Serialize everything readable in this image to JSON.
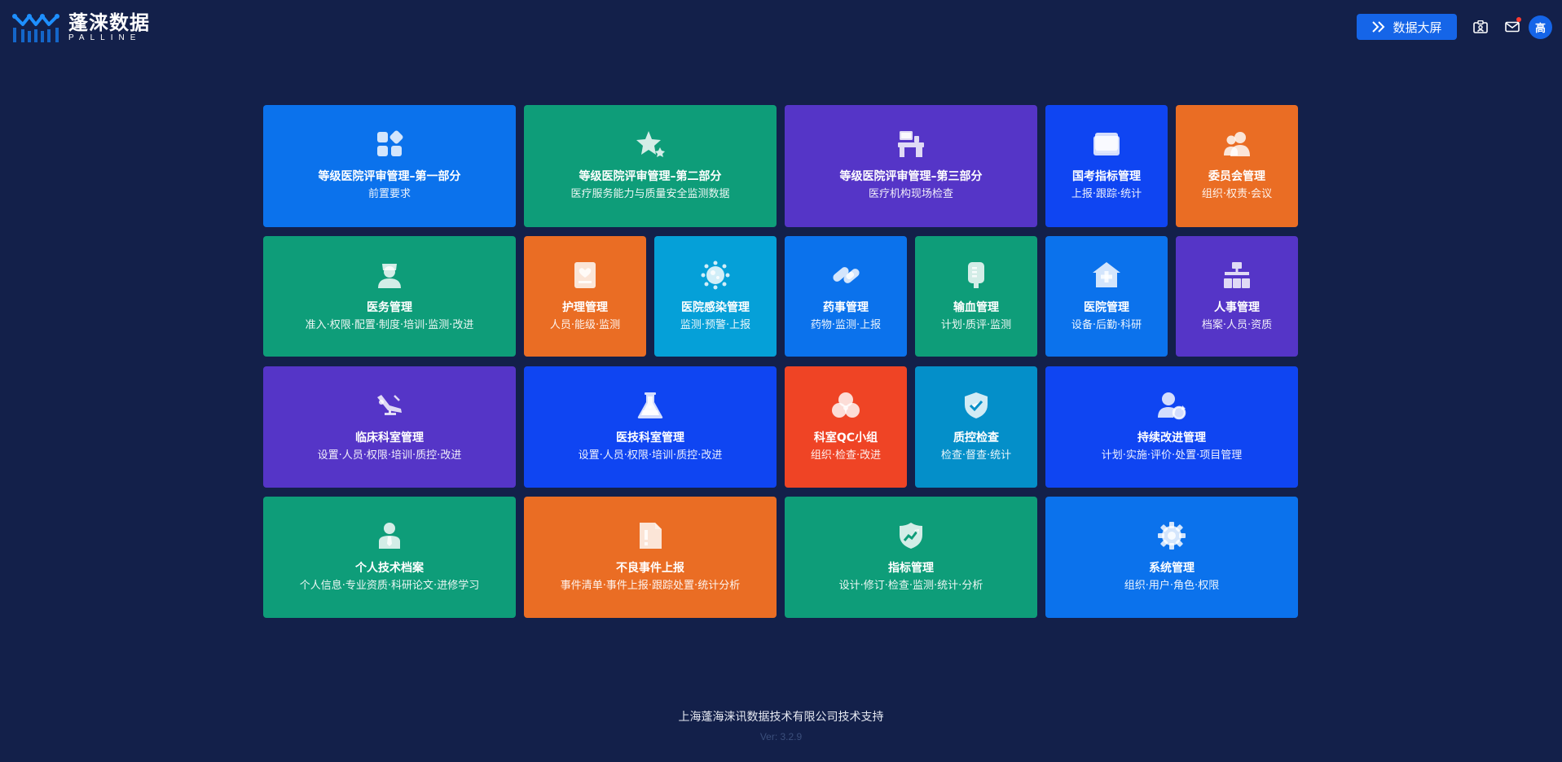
{
  "header": {
    "logo_cn": "蓬涞数据",
    "logo_en": "PALLINE",
    "screen_button_label": "数据大屏",
    "avatar_text": "高"
  },
  "tiles": [
    {
      "title": "等级医院评审管理–第一部分",
      "subtitle": "前置要求",
      "icon": "apps-icon",
      "color": "#0b72ec"
    },
    {
      "title": "等级医院评审管理–第二部分",
      "subtitle": "医疗服务能力与质量安全监测数据",
      "icon": "star-icon",
      "color": "#0e9d79"
    },
    {
      "title": "等级医院评审管理–第三部分",
      "subtitle": "医疗机构现场检查",
      "icon": "inspection-icon",
      "color": "#5535c7"
    },
    {
      "title": "国考指标管理",
      "subtitle": "上报·跟踪·统计",
      "icon": "cards-icon",
      "color": "#0f45f2"
    },
    {
      "title": "委员会管理",
      "subtitle": "组织·权责·会议",
      "icon": "users-icon",
      "color": "#ea6d24"
    },
    {
      "title": "医务管理",
      "subtitle": "准入·权限·配置·制度·培训·监测·改进",
      "icon": "doctor-icon",
      "color": "#0e9d79"
    },
    {
      "title": "护理管理",
      "subtitle": "人员·能级·监测",
      "icon": "nursing-icon",
      "color": "#ea6d24"
    },
    {
      "title": "医院感染管理",
      "subtitle": "监测·预警·上报",
      "icon": "virus-icon",
      "color": "#05a0d8"
    },
    {
      "title": "药事管理",
      "subtitle": "药物·监测·上报",
      "icon": "pills-icon",
      "color": "#0b72ec"
    },
    {
      "title": "输血管理",
      "subtitle": "计划·质评·监测",
      "icon": "blood-bag-icon",
      "color": "#0e9d79"
    },
    {
      "title": "医院管理",
      "subtitle": "设备·后勤·科研",
      "icon": "hospital-icon",
      "color": "#0b72ec"
    },
    {
      "title": "人事管理",
      "subtitle": "档案·人员·资质",
      "icon": "org-chart-icon",
      "color": "#5535c7"
    },
    {
      "title": "临床科室管理",
      "subtitle": "设置·人员·权限·培训·质控·改进",
      "icon": "dental-chair-icon",
      "color": "#5535c7"
    },
    {
      "title": "医技科室管理",
      "subtitle": "设置·人员·权限·培训·质控·改进",
      "icon": "flask-icon",
      "color": "#0f45f2"
    },
    {
      "title": "科室QC小组",
      "subtitle": "组织·检查·改进",
      "icon": "group-circles-icon",
      "color": "#ef4425"
    },
    {
      "title": "质控检查",
      "subtitle": "检查·督查·统计",
      "icon": "shield-check-icon",
      "color": "#048fc9"
    },
    {
      "title": "持续改进管理",
      "subtitle": "计划·实施·评价·处置·项目管理",
      "icon": "user-refresh-icon",
      "color": "#0f45f2"
    },
    {
      "title": "个人技术档案",
      "subtitle": "个人信息·专业资质·科研论文·进修学习",
      "icon": "person-tie-icon",
      "color": "#0e9d79"
    },
    {
      "title": "不良事件上报",
      "subtitle": "事件清单·事件上报·跟踪处置·统计分析",
      "icon": "alert-document-icon",
      "color": "#ea6d24"
    },
    {
      "title": "指标管理",
      "subtitle": "设计·修订·检查·监测·统计·分析",
      "icon": "trend-shield-icon",
      "color": "#0e9d79"
    },
    {
      "title": "系统管理",
      "subtitle": "组织·用户·角色·权限",
      "icon": "gear-icon",
      "color": "#0b72ec"
    }
  ],
  "footer": {
    "company": "上海蓬海涞讯数据技术有限公司技术支持",
    "version": "Ver: 3.2.9"
  }
}
